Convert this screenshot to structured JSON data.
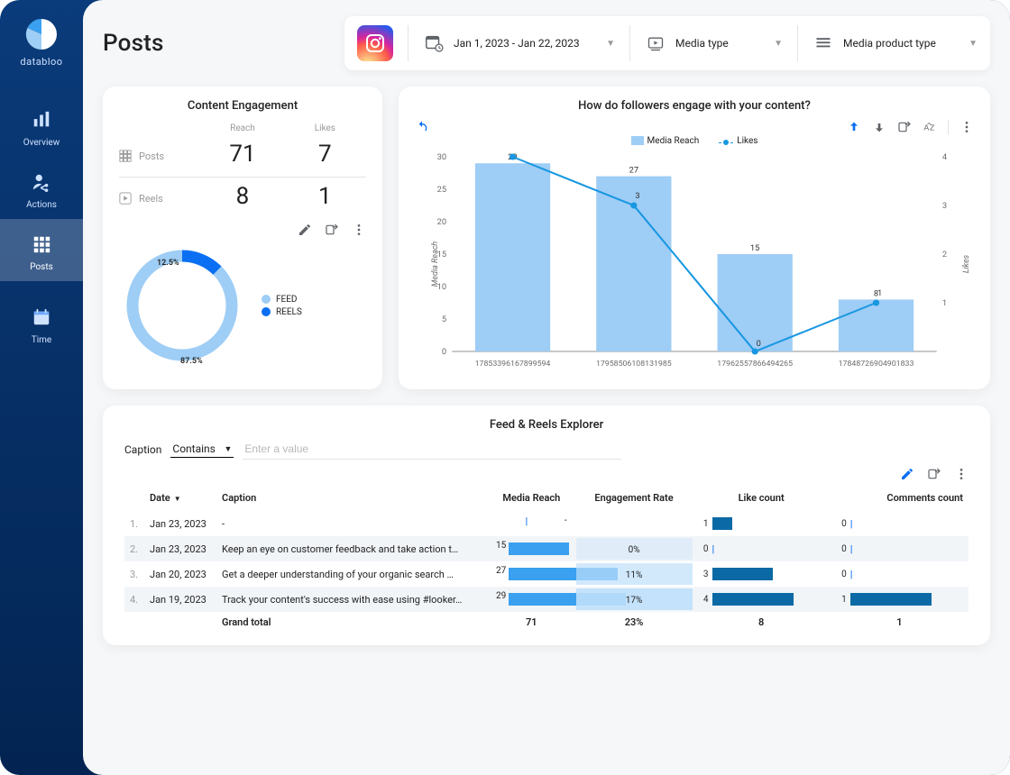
{
  "brand": "databloo",
  "nav": [
    {
      "id": "overview",
      "label": "Overview",
      "active": false
    },
    {
      "id": "actions",
      "label": "Actions",
      "active": false
    },
    {
      "id": "posts",
      "label": "Posts",
      "active": true
    },
    {
      "id": "time",
      "label": "Time",
      "active": false
    }
  ],
  "page_title": "Posts",
  "filters": {
    "date_range": "Jan 1, 2023 - Jan 22, 2023",
    "media_type_label": "Media type",
    "media_product_type_label": "Media product type"
  },
  "engagement_card": {
    "title": "Content Engagement",
    "headers": {
      "reach": "Reach",
      "likes": "Likes"
    },
    "rows": [
      {
        "label": "Posts",
        "reach": 71,
        "likes": 7
      },
      {
        "label": "Reels",
        "reach": 8,
        "likes": 1
      }
    ],
    "donut": {
      "feed_pct": 87.5,
      "reels_pct": 12.5,
      "legend": {
        "feed": "FEED",
        "reels": "REELS"
      },
      "colors": {
        "feed": "#9ecdf5",
        "reels": "#0a6ff2"
      }
    }
  },
  "chart_card": {
    "title": "How do followers engage with your content?",
    "legend": {
      "reach": "Media Reach",
      "likes": "Likes"
    },
    "y1_label": "Media Reach",
    "y2_label": "Likes"
  },
  "chart_data": {
    "type": "bar",
    "title": "How do followers engage with your content?",
    "categories": [
      "17853396167899594",
      "17958506108131985",
      "17962557866494265",
      "17848726904901833"
    ],
    "series": [
      {
        "name": "Media Reach",
        "type": "bar",
        "values": [
          29,
          27,
          15,
          8
        ]
      },
      {
        "name": "Likes",
        "type": "line",
        "values": [
          4,
          3,
          0,
          1
        ]
      }
    ],
    "ylabel": "Media Reach",
    "ylim": [
      0,
      30
    ],
    "y2label": "Likes",
    "y2lim": [
      0,
      4
    ],
    "bar_labels": [
      29,
      27,
      15,
      8
    ],
    "line_labels": [
      4,
      3,
      0,
      1
    ]
  },
  "table_card": {
    "title": "Feed & Reels Explorer",
    "filter_label": "Caption",
    "filter_operator": "Contains",
    "input_placeholder": "Enter a value",
    "columns": {
      "idx": "",
      "date": "Date",
      "caption": "Caption",
      "reach": "Media Reach",
      "eng": "Engagement Rate",
      "likes": "Like count",
      "comments": "Comments count"
    },
    "rows": [
      {
        "idx": "1.",
        "date": "Jan 23, 2023",
        "caption": "-",
        "reach": null,
        "reach_txt": "-",
        "eng_txt": "",
        "eng": null,
        "likes": 1,
        "comments": 0
      },
      {
        "idx": "2.",
        "date": "Jan 23, 2023",
        "caption": "Keep an eye on customer feedback and take action t…",
        "reach": 15,
        "reach_txt": "15",
        "eng_txt": "0%",
        "eng": 0,
        "likes": 0,
        "comments": 0
      },
      {
        "idx": "3.",
        "date": "Jan 20, 2023",
        "caption": "Get a deeper understanding of your organic search …",
        "reach": 27,
        "reach_txt": "27",
        "eng_txt": "11%",
        "eng": 11,
        "likes": 3,
        "comments": 0
      },
      {
        "idx": "4.",
        "date": "Jan 19, 2023",
        "caption": "Track your content's success with ease using #looker…",
        "reach": 29,
        "reach_txt": "29",
        "eng_txt": "17%",
        "eng": 17,
        "likes": 4,
        "comments": 1
      }
    ],
    "grand_total_label": "Grand total",
    "grand_total": {
      "reach": 71,
      "eng": "23%",
      "likes": 8,
      "comments": 1
    },
    "max_reach": 29,
    "max_likes": 4,
    "max_comments": 1
  }
}
